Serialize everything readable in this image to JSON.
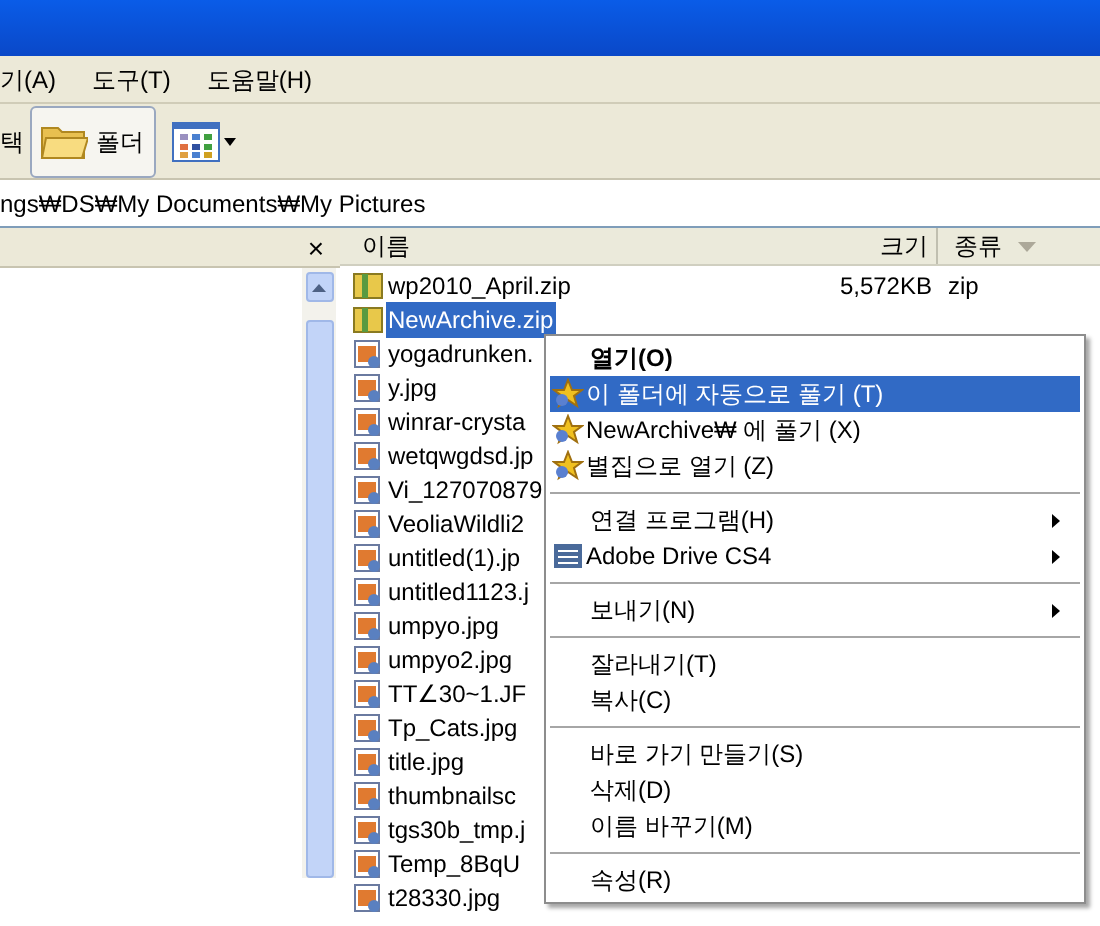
{
  "menu_bar": [
    "기(A)",
    "도구(T)",
    "도움말(H)"
  ],
  "toolbar": {
    "partial_label": "택",
    "folder_button": "폴더"
  },
  "address": "ngs₩DS₩My Documents₩My Pictures",
  "left_pane": {
    "close": "×"
  },
  "columns": [
    "이름",
    "크기",
    "종류"
  ],
  "files": [
    {
      "name": "wp2010_April.zip",
      "size": "5,572KB",
      "type": "zip",
      "kind": "zip",
      "selected": false
    },
    {
      "name": "NewArchive.zip",
      "kind": "zip",
      "selected": true
    },
    {
      "name": "yogadrunken.",
      "kind": "image",
      "selected": false
    },
    {
      "name": "y.jpg",
      "kind": "image",
      "selected": false
    },
    {
      "name": "winrar-crysta",
      "kind": "image",
      "selected": false
    },
    {
      "name": "wetqwgdsd.jp",
      "kind": "image",
      "selected": false
    },
    {
      "name": "Vi_127070879",
      "kind": "image",
      "selected": false
    },
    {
      "name": "VeoliaWildli2",
      "kind": "image",
      "selected": false
    },
    {
      "name": "untitled(1).jp",
      "kind": "image",
      "selected": false
    },
    {
      "name": "untitled1123.j",
      "kind": "image",
      "selected": false
    },
    {
      "name": "umpyo.jpg",
      "kind": "image",
      "selected": false
    },
    {
      "name": "umpyo2.jpg",
      "kind": "image",
      "selected": false
    },
    {
      "name": "TT∠30~1.JF",
      "kind": "image",
      "selected": false
    },
    {
      "name": "Tp_Cats.jpg",
      "kind": "image",
      "selected": false
    },
    {
      "name": "title.jpg",
      "kind": "image",
      "selected": false
    },
    {
      "name": "thumbnailsc",
      "kind": "image",
      "selected": false
    },
    {
      "name": "tgs30b_tmp.j",
      "kind": "image",
      "selected": false
    },
    {
      "name": "Temp_8BqU",
      "kind": "image",
      "selected": false
    },
    {
      "name": "t28330.jpg",
      "kind": "image",
      "selected": false
    }
  ],
  "context_menu": [
    {
      "kind": "item",
      "label": "열기(O)",
      "bold": true,
      "selected": false,
      "submenu": false
    },
    {
      "kind": "archive",
      "label": "이 폴더에 자동으로 풀기 (T)",
      "selected": true,
      "submenu": false
    },
    {
      "kind": "archive",
      "label": "NewArchive₩ 에 풀기 (X)",
      "selected": false,
      "submenu": false
    },
    {
      "kind": "archive",
      "label": "별집으로 열기 (Z)",
      "selected": false,
      "submenu": false
    },
    {
      "kind": "separator"
    },
    {
      "kind": "item",
      "label": "연결 프로그램(H)",
      "selected": false,
      "submenu": true
    },
    {
      "kind": "app",
      "label": "Adobe Drive CS4",
      "selected": false,
      "submenu": true
    },
    {
      "kind": "separator"
    },
    {
      "kind": "item",
      "label": "보내기(N)",
      "selected": false,
      "submenu": true
    },
    {
      "kind": "separator"
    },
    {
      "kind": "item",
      "label": "잘라내기(T)",
      "selected": false,
      "submenu": false
    },
    {
      "kind": "item",
      "label": "복사(C)",
      "selected": false,
      "submenu": false
    },
    {
      "kind": "separator"
    },
    {
      "kind": "item",
      "label": "바로 가기 만들기(S)",
      "selected": false,
      "submenu": false
    },
    {
      "kind": "item",
      "label": "삭제(D)",
      "selected": false,
      "submenu": false
    },
    {
      "kind": "item",
      "label": "이름 바꾸기(M)",
      "selected": false,
      "submenu": false
    },
    {
      "kind": "separator"
    },
    {
      "kind": "item",
      "label": "속성(R)",
      "selected": false,
      "submenu": false
    }
  ]
}
